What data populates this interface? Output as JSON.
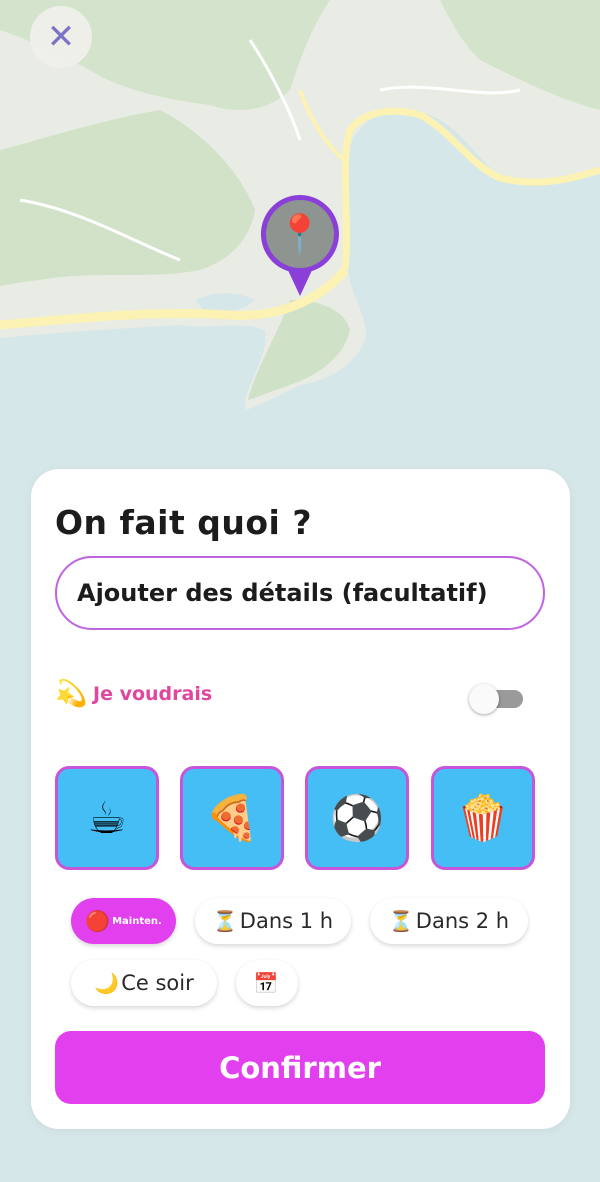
{
  "header": {
    "close_label": "✕"
  },
  "map": {
    "pin_emoji": "📍",
    "pin_color": "#8b3fd9"
  },
  "sheet": {
    "title": "On fait quoi ?",
    "details_placeholder": "Ajouter des détails (facultatif)",
    "wish": {
      "emoji": "💫",
      "label": "Je voudrais",
      "enabled": false
    },
    "activities": [
      {
        "emoji": "☕",
        "name": "coffee"
      },
      {
        "emoji": "🍕",
        "name": "pizza"
      },
      {
        "emoji": "⚽",
        "name": "soccer"
      },
      {
        "emoji": "🍿",
        "name": "popcorn"
      }
    ],
    "times": [
      {
        "emoji": "🔴",
        "label": "Mainten.",
        "selected": true
      },
      {
        "emoji": "⏳",
        "label": "Dans 1 h",
        "selected": false
      },
      {
        "emoji": "⏳",
        "label": "Dans 2 h",
        "selected": false
      },
      {
        "emoji": "🌙",
        "label": "Ce soir",
        "selected": false
      },
      {
        "emoji": "📅",
        "label": "",
        "selected": false
      }
    ],
    "confirm_label": "Confirmer"
  },
  "colors": {
    "accent": "#e240ef",
    "tile_bg": "#45bdf5",
    "tile_border": "#c755d9",
    "wish_text": "#e0479e"
  }
}
